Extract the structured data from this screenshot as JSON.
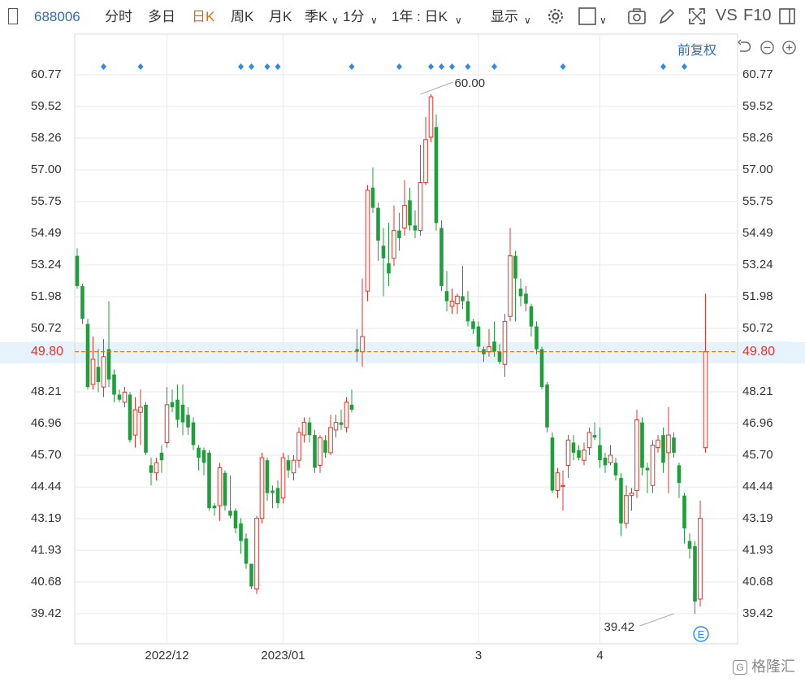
{
  "toolbar": {
    "stock_code": "688006",
    "period_tabs": [
      "分时",
      "多日",
      "日K",
      "周K",
      "月K",
      "季K"
    ],
    "active_tab": "日K",
    "interval": "1分",
    "range": "1年 : 日K",
    "display": "显示",
    "vs": "VS",
    "f10": "F10",
    "adjust": "前复权"
  },
  "colors": {
    "up": "#e0352b",
    "down": "#1f9f3b",
    "grid": "#e9e9e9",
    "current_line": "#e36b0c",
    "marker": "#2b8be6",
    "highlight": "#e6f2fc"
  },
  "icons": [
    "settings-icon",
    "checkbox-icon",
    "camera-icon",
    "pencil-icon",
    "fullscreen-icon",
    "panel-icon",
    "reset-icon",
    "zoom-out-icon",
    "zoom-in-icon",
    "e-badge-icon"
  ],
  "watermark": "格隆汇",
  "chart_data": {
    "type": "candlestick",
    "y_ticks": [
      "60.77",
      "59.52",
      "58.26",
      "57.00",
      "55.75",
      "54.49",
      "53.24",
      "51.98",
      "50.72",
      "49.80",
      "48.21",
      "46.96",
      "45.70",
      "44.44",
      "43.19",
      "41.93",
      "40.68",
      "39.42"
    ],
    "ylim": [
      39.42,
      60.77
    ],
    "x_labels": [
      {
        "label": "2022/12",
        "index": 17
      },
      {
        "label": "2023/01",
        "index": 39
      },
      {
        "label": "3",
        "index": 76
      },
      {
        "label": "4",
        "index": 99
      }
    ],
    "current_price": 49.8,
    "current_price_label": "49.80",
    "high_label": {
      "value": 60.0,
      "text": "60.00",
      "index": 65
    },
    "low_label": {
      "value": 39.42,
      "text": "39.42",
      "index": 113
    },
    "event_marker_indices": [
      5,
      12,
      31,
      33,
      36,
      38,
      52,
      61,
      67,
      69,
      71,
      74,
      79,
      92,
      111,
      115
    ],
    "candles": [
      [
        53.6,
        52.4,
        53.9,
        52.3
      ],
      [
        52.4,
        51.1,
        52.5,
        50.9
      ],
      [
        50.9,
        48.4,
        51.1,
        48.3
      ],
      [
        48.5,
        49.5,
        50.4,
        48.3
      ],
      [
        49.2,
        48.6,
        49.9,
        48.2
      ],
      [
        48.4,
        49.6,
        50.3,
        48.0
      ],
      [
        49.9,
        48.7,
        51.8,
        48.4
      ],
      [
        48.9,
        48.1,
        49.1,
        47.8
      ],
      [
        48.1,
        47.9,
        48.3,
        47.8
      ],
      [
        47.8,
        48.2,
        48.4,
        47.6
      ],
      [
        48.1,
        46.3,
        48.2,
        46.2
      ],
      [
        46.5,
        47.5,
        48.0,
        46.0
      ],
      [
        47.4,
        47.6,
        48.3,
        46.1
      ],
      [
        47.7,
        45.8,
        47.8,
        45.7
      ],
      [
        45.3,
        45.0,
        45.6,
        44.5
      ],
      [
        45.0,
        45.4,
        45.6,
        44.7
      ],
      [
        45.8,
        45.5,
        46.1,
        45.0
      ],
      [
        46.2,
        47.7,
        48.4,
        46.0
      ],
      [
        47.8,
        47.6,
        48.3,
        47.4
      ],
      [
        47.9,
        47.1,
        48.5,
        46.8
      ],
      [
        47.7,
        47.0,
        48.5,
        46.5
      ],
      [
        47.3,
        46.8,
        47.6,
        46.5
      ],
      [
        47.0,
        46.1,
        47.2,
        45.9
      ],
      [
        46.0,
        45.6,
        46.1,
        45.1
      ],
      [
        45.9,
        45.4,
        46.0,
        44.9
      ],
      [
        45.8,
        43.6,
        45.9,
        43.5
      ],
      [
        43.7,
        43.6,
        43.8,
        43.3
      ],
      [
        43.7,
        45.2,
        45.4,
        43.1
      ],
      [
        45.0,
        43.7,
        45.1,
        43.5
      ],
      [
        43.5,
        43.3,
        44.9,
        43.2
      ],
      [
        43.5,
        42.8,
        43.6,
        42.6
      ],
      [
        43.0,
        42.3,
        43.2,
        41.8
      ],
      [
        42.4,
        41.4,
        42.6,
        41.2
      ],
      [
        41.4,
        40.5,
        41.4,
        40.4
      ],
      [
        40.4,
        43.2,
        43.3,
        40.2
      ],
      [
        43.2,
        45.6,
        45.8,
        43.0
      ],
      [
        45.5,
        44.2,
        45.6,
        43.9
      ],
      [
        44.3,
        44.2,
        44.5,
        43.6
      ],
      [
        44.4,
        43.8,
        44.7,
        43.6
      ],
      [
        44.0,
        45.6,
        45.8,
        43.8
      ],
      [
        45.5,
        45.1,
        45.7,
        44.8
      ],
      [
        45.0,
        45.5,
        45.7,
        44.7
      ],
      [
        45.5,
        46.6,
        46.8,
        45.2
      ],
      [
        46.5,
        47.0,
        47.2,
        46.2
      ],
      [
        47.0,
        46.5,
        47.2,
        46.2
      ],
      [
        46.5,
        45.2,
        46.7,
        45.0
      ],
      [
        45.3,
        46.4,
        46.5,
        45.0
      ],
      [
        46.3,
        45.8,
        46.5,
        45.6
      ],
      [
        45.8,
        46.8,
        47.3,
        45.7
      ],
      [
        46.7,
        47.0,
        47.3,
        46.4
      ],
      [
        47.0,
        46.9,
        47.5,
        46.7
      ],
      [
        46.8,
        47.8,
        48.0,
        46.6
      ],
      [
        47.7,
        47.5,
        48.3,
        47.4
      ],
      [
        49.9,
        49.8,
        50.7,
        49.4
      ],
      [
        49.8,
        50.4,
        52.7,
        49.2
      ],
      [
        52.2,
        56.2,
        56.4,
        51.8
      ],
      [
        56.3,
        55.5,
        57.1,
        55.3
      ],
      [
        55.5,
        54.2,
        55.7,
        53.4
      ],
      [
        54.0,
        53.5,
        54.7,
        52.0
      ],
      [
        53.3,
        52.9,
        54.9,
        52.4
      ],
      [
        53.5,
        54.6,
        55.6,
        53.2
      ],
      [
        54.6,
        54.3,
        55.3,
        53.8
      ],
      [
        54.7,
        55.6,
        56.6,
        54.4
      ],
      [
        55.8,
        54.8,
        56.3,
        54.6
      ],
      [
        54.8,
        54.6,
        55.4,
        54.3
      ],
      [
        54.6,
        56.5,
        58.0,
        54.4
      ],
      [
        56.5,
        58.2,
        59.1,
        56.4
      ],
      [
        58.3,
        59.9,
        60.0,
        58.1
      ],
      [
        58.7,
        54.9,
        59.2,
        54.6
      ],
      [
        54.7,
        52.4,
        55.0,
        52.2
      ],
      [
        52.2,
        51.8,
        53.0,
        51.4
      ],
      [
        51.6,
        51.8,
        52.3,
        51.3
      ],
      [
        51.7,
        52.0,
        52.1,
        51.3
      ],
      [
        52.0,
        51.8,
        53.2,
        51.5
      ],
      [
        51.8,
        51.0,
        52.2,
        50.8
      ],
      [
        51.0,
        50.7,
        51.1,
        50.5
      ],
      [
        50.8,
        50.0,
        51.0,
        49.8
      ],
      [
        49.9,
        49.7,
        50.0,
        49.4
      ],
      [
        49.8,
        50.0,
        50.7,
        49.6
      ],
      [
        50.2,
        49.8,
        51.0,
        49.6
      ],
      [
        49.8,
        49.4,
        50.1,
        49.3
      ],
      [
        49.3,
        51.0,
        51.3,
        48.8
      ],
      [
        51.2,
        53.6,
        54.7,
        51.0
      ],
      [
        53.6,
        52.7,
        53.8,
        51.0
      ],
      [
        52.3,
        52.0,
        52.7,
        51.6
      ],
      [
        52.1,
        51.7,
        52.4,
        51.4
      ],
      [
        51.6,
        50.8,
        51.7,
        50.4
      ],
      [
        50.8,
        49.9,
        51.0,
        49.7
      ],
      [
        49.9,
        48.4,
        50.0,
        48.3
      ],
      [
        48.5,
        46.8,
        48.6,
        46.6
      ],
      [
        46.4,
        44.3,
        46.6,
        44.2
      ],
      [
        44.3,
        45.0,
        45.2,
        44.0
      ],
      [
        44.5,
        44.5,
        45.1,
        43.5
      ],
      [
        45.3,
        46.3,
        46.5,
        44.8
      ],
      [
        46.2,
        45.8,
        46.5,
        45.5
      ],
      [
        45.9,
        45.6,
        46.1,
        45.5
      ],
      [
        45.5,
        45.9,
        46.2,
        45.3
      ],
      [
        46.0,
        46.6,
        46.8,
        45.7
      ],
      [
        46.5,
        46.4,
        47.0,
        46.3
      ],
      [
        46.1,
        45.5,
        46.8,
        45.2
      ],
      [
        45.6,
        45.3,
        45.8,
        45.0
      ],
      [
        45.4,
        45.7,
        46.1,
        45.3
      ],
      [
        45.4,
        44.9,
        45.6,
        44.7
      ],
      [
        44.8,
        43.0,
        45.0,
        42.5
      ],
      [
        43.0,
        44.1,
        44.5,
        42.8
      ],
      [
        44.1,
        44.2,
        44.4,
        43.5
      ],
      [
        44.3,
        47.1,
        47.5,
        44.0
      ],
      [
        47.0,
        45.2,
        47.2,
        44.9
      ],
      [
        45.2,
        45.1,
        45.4,
        44.2
      ],
      [
        44.5,
        46.1,
        46.3,
        44.2
      ],
      [
        46.0,
        46.3,
        46.5,
        45.8
      ],
      [
        46.5,
        45.4,
        46.8,
        45.0
      ],
      [
        45.8,
        46.5,
        47.6,
        44.2
      ],
      [
        46.4,
        45.8,
        46.6,
        45.6
      ],
      [
        45.3,
        44.6,
        45.4,
        44.0
      ],
      [
        44.1,
        42.8,
        44.2,
        42.2
      ],
      [
        42.3,
        42.0,
        42.6,
        41.6
      ],
      [
        42.1,
        39.9,
        42.3,
        39.42
      ],
      [
        40.0,
        43.2,
        43.9,
        39.7
      ],
      [
        46.0,
        49.8,
        52.1,
        45.8
      ]
    ]
  }
}
